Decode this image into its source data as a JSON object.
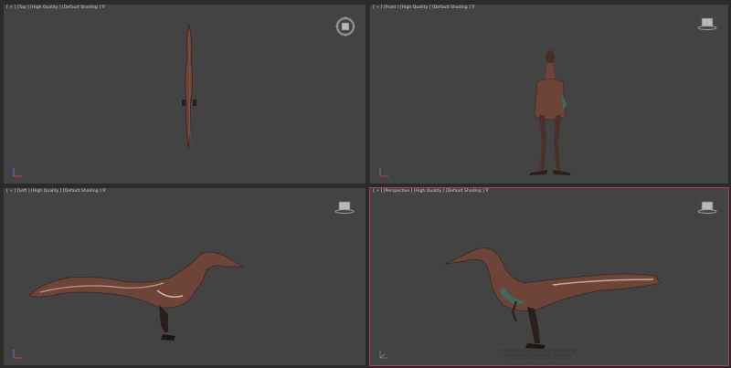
{
  "viewports": {
    "top": {
      "plus": "[ + ]",
      "view": "[Top ]",
      "quality": "[High Quality ]",
      "shading": "[Default Shading ]",
      "filter": "∇"
    },
    "front": {
      "plus": "[ + ]",
      "view": "[Front ]",
      "quality": "[High Quality ]",
      "shading": "[Default Shading ]",
      "filter": "∇"
    },
    "left": {
      "plus": "[ + ]",
      "view": "[Left ]",
      "quality": "[High Quality ]",
      "shading": "[Default Shading ]",
      "filter": "∇"
    },
    "perspective": {
      "plus": "[ + ]",
      "view": "[Perspective ]",
      "quality": "[High Quality ]",
      "shading": "[Default Shading ]",
      "filter": "∇"
    }
  },
  "colors": {
    "viewport_bg": "#434343",
    "active_border": "#b5395a",
    "model_body": "#6e4439",
    "model_dark": "#2a1f1d"
  },
  "icons": {
    "navigation": "viewcube-icon",
    "axis": "axis-tripod-icon"
  }
}
